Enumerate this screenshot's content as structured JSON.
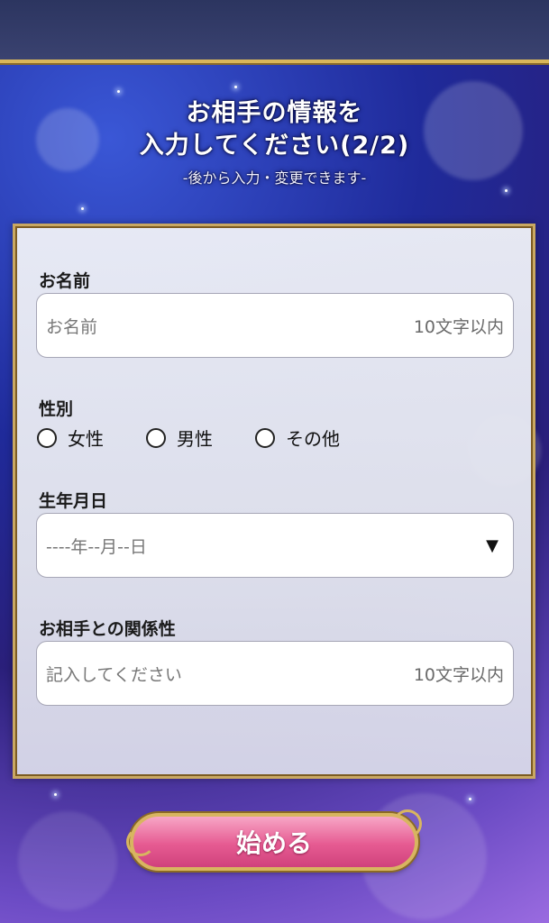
{
  "header": {
    "title_line1": "お相手の情報を",
    "title_line2": "入力してください(2/2)",
    "subtitle": "-後から入力・変更できます-"
  },
  "form": {
    "name": {
      "label": "お名前",
      "placeholder": "お名前",
      "limit": "10文字以内"
    },
    "gender": {
      "label": "性別",
      "options": [
        "女性",
        "男性",
        "その他"
      ]
    },
    "birthdate": {
      "label": "生年月日",
      "value": "----年--月--日"
    },
    "relationship": {
      "label": "お相手との関係性",
      "placeholder": "記入してください",
      "limit": "10文字以内"
    }
  },
  "start_button": {
    "label": "始める"
  },
  "colors": {
    "accent_gold": "#d8b560",
    "button_pink": "#e65b92",
    "header_bar": "#2c3560"
  }
}
